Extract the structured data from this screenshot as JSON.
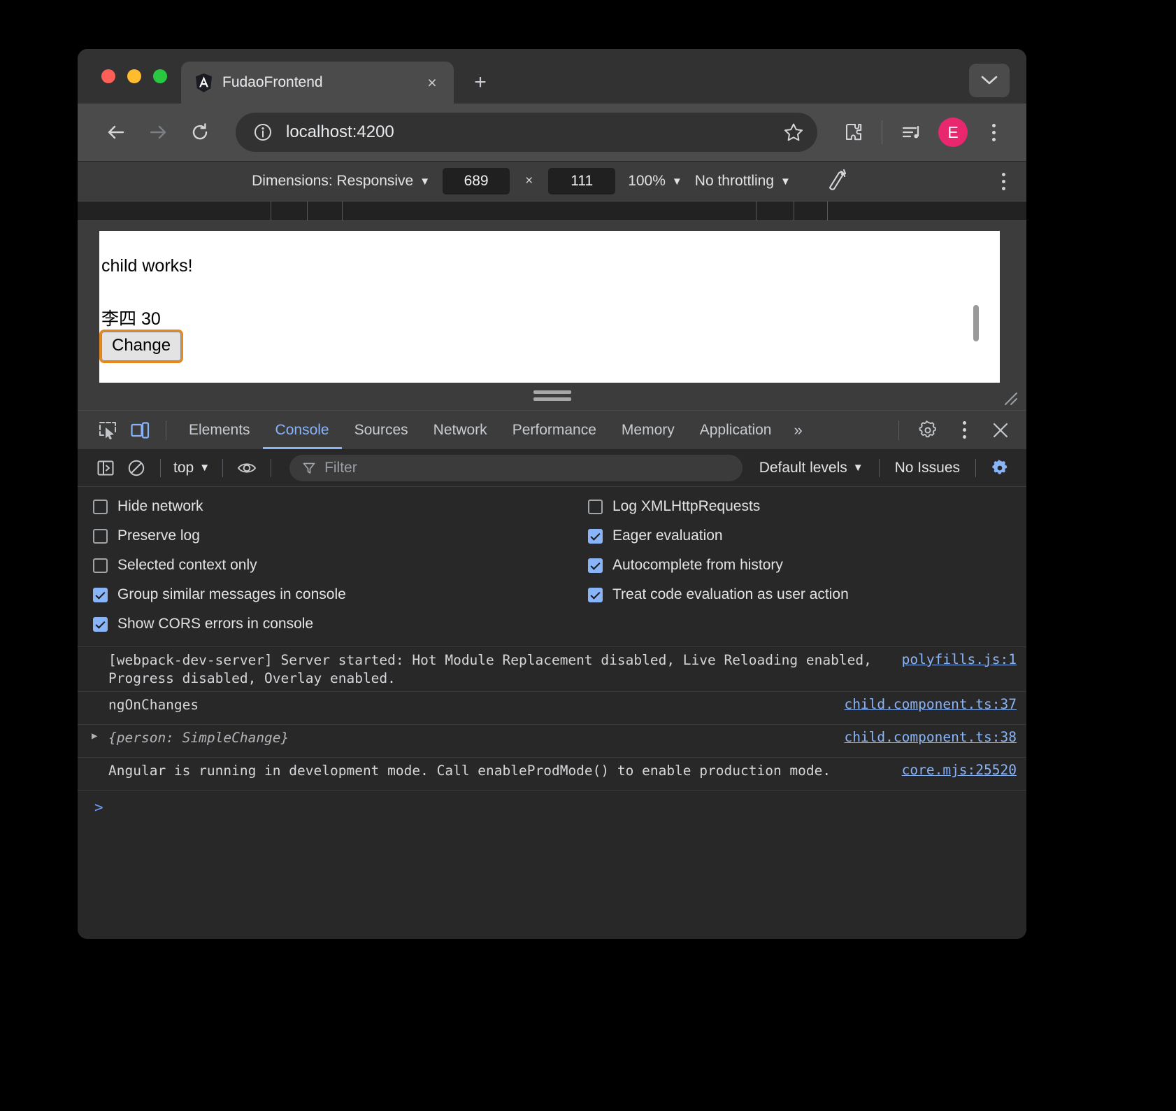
{
  "window": {
    "traffic_lights": [
      "close",
      "minimize",
      "maximize"
    ]
  },
  "tabstrip": {
    "tab_title": "FudaoFrontend",
    "favicon_name": "angular-logo-icon",
    "close_label": "×",
    "new_tab_label": "+",
    "tab_list_label": "tab-search"
  },
  "toolbar": {
    "back_label": "←",
    "forward_label": "→",
    "reload_label": "⟳",
    "url": "localhost:4200",
    "site_info_label": "i",
    "bookmark_label": "star",
    "extensions_label": "extensions",
    "media_label": "media-control",
    "profile_initial": "E",
    "menu_label": "chrome-menu"
  },
  "device_toolbar": {
    "dimensions_label": "Dimensions: Responsive",
    "width": "689",
    "height": "111",
    "multiply": "×",
    "zoom": "100%",
    "throttling": "No throttling",
    "rotate_label": "rotate",
    "more_label": "more-options"
  },
  "page": {
    "heading": "child works!",
    "person_line": "李四 30",
    "change_button": "Change"
  },
  "devtools": {
    "inspect_label": "inspect-element",
    "device_toggle_label": "toggle-device-toolbar",
    "tabs": [
      {
        "label": "Elements",
        "active": false
      },
      {
        "label": "Console",
        "active": true
      },
      {
        "label": "Sources",
        "active": false
      },
      {
        "label": "Network",
        "active": false
      },
      {
        "label": "Performance",
        "active": false
      },
      {
        "label": "Memory",
        "active": false
      },
      {
        "label": "Application",
        "active": false
      }
    ],
    "more_tabs_label": "»",
    "settings_label": "settings",
    "dots_label": "customize",
    "close_label": "×"
  },
  "console_toolbar": {
    "sidebar_label": "console-sidebar",
    "clear_label": "clear-console",
    "context": "top",
    "eye_label": "live-expressions",
    "filter_placeholder": "Filter",
    "levels": "Default levels",
    "issues": "No Issues",
    "settings_label": "console-settings"
  },
  "console_settings": {
    "left": [
      {
        "label": "Hide network",
        "checked": false
      },
      {
        "label": "Preserve log",
        "checked": false
      },
      {
        "label": "Selected context only",
        "checked": false
      },
      {
        "label": "Group similar messages in console",
        "checked": true
      },
      {
        "label": "Show CORS errors in console",
        "checked": true
      }
    ],
    "right": [
      {
        "label": "Log XMLHttpRequests",
        "checked": false
      },
      {
        "label": "Eager evaluation",
        "checked": true
      },
      {
        "label": "Autocomplete from history",
        "checked": true
      },
      {
        "label": "Treat code evaluation as user action",
        "checked": true
      }
    ]
  },
  "console_messages": [
    {
      "text": "[webpack-dev-server] Server started: Hot Module Replacement disabled, Live Reloading enabled, Progress disabled, Overlay enabled.",
      "source": "polyfills.js:1",
      "expandable": false,
      "object": false
    },
    {
      "text": "ngOnChanges",
      "source": "child.component.ts:37",
      "expandable": false,
      "object": false
    },
    {
      "text": "{person: SimpleChange}",
      "source": "child.component.ts:38",
      "expandable": true,
      "object": true
    },
    {
      "text": "Angular is running in development mode. Call enableProdMode() to enable production mode.",
      "source": "core.mjs:25520",
      "expandable": false,
      "object": false
    }
  ],
  "console_prompt": {
    "caret": ">"
  },
  "colors": {
    "accent_blue": "#8ab4f8",
    "avatar_pink": "#e8276f",
    "focus_orange": "#e8871a",
    "window_bg": "#323232",
    "devtools_bg": "#282828"
  }
}
